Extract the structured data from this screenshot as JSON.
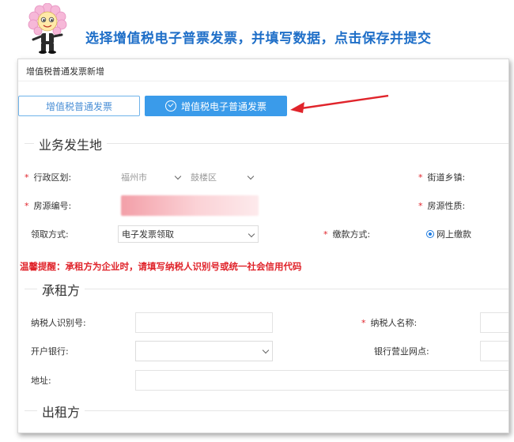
{
  "banner": {
    "instruction": "选择增值税电子普票发票，并填写数据，点击保存并提交"
  },
  "panel": {
    "title": "增值税普通发票新增",
    "invoice_types": {
      "plain_label": "增值税普通发票",
      "active_label": "增值税电子普通发票"
    }
  },
  "business": {
    "section_title": "业务发生地",
    "district_label": "行政区划:",
    "city_value": "福州市",
    "district_value": "鼓楼区",
    "street_label": "街道乡镇:",
    "house_no_label": "房源编号:",
    "house_type_label": "房源性质:",
    "receive_label": "领取方式:",
    "receive_value": "电子发票领取",
    "pay_label": "缴款方式:",
    "pay_value": "网上缴款"
  },
  "tip": "温馨提醒：承租方为企业时，请填写纳税人识别号或统一社会信用代码",
  "lessee": {
    "section_title": "承租方",
    "tax_id_label": "纳税人识别号:",
    "taxpayer_name_label": "纳税人名称:",
    "bank_label": "开户银行:",
    "branch_label": "银行营业网点:",
    "address_label": "地址:"
  },
  "lessor": {
    "section_title": "出租方"
  },
  "colors": {
    "accent": "#3a9bea",
    "warning": "#e0242b",
    "banner": "#1f6fc8"
  }
}
